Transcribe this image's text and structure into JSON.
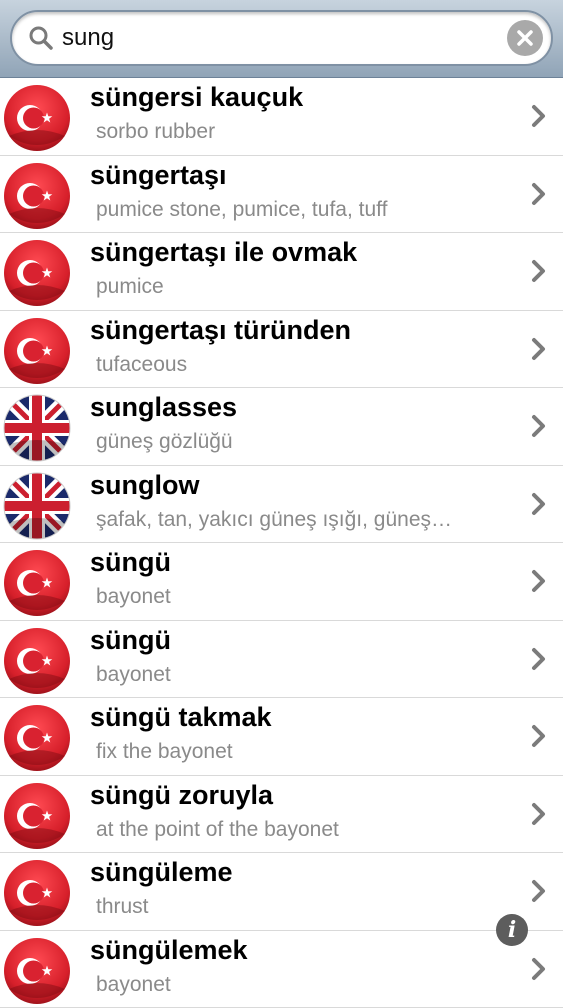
{
  "search": {
    "value": "sung",
    "icon": "search-icon",
    "clear_icon": "clear-icon"
  },
  "colors": {
    "turkish_red": "#d9202b",
    "uk_blue": "#1b2a6b",
    "uk_red": "#cc1f2f",
    "subtitle_gray": "#8a8a8a"
  },
  "results": [
    {
      "flag": "tr",
      "word": "süngersi kauçuk",
      "translation": "sorbo rubber"
    },
    {
      "flag": "tr",
      "word": "süngertaşı",
      "translation": "pumice stone, pumice, tufa, tuff"
    },
    {
      "flag": "tr",
      "word": "süngertaşı ile ovmak",
      "translation": "pumice"
    },
    {
      "flag": "tr",
      "word": "süngertaşı türünden",
      "translation": "tufaceous"
    },
    {
      "flag": "uk",
      "word": "sunglasses",
      "translation": "güneş gözlüğü"
    },
    {
      "flag": "uk",
      "word": "sunglow",
      "translation": "şafak, tan, yakıcı güneş ışığı, güneş…"
    },
    {
      "flag": "tr",
      "word": "süngü",
      "translation": "bayonet"
    },
    {
      "flag": "tr",
      "word": "süngü",
      "translation": "bayonet"
    },
    {
      "flag": "tr",
      "word": "süngü takmak",
      "translation": "fix the bayonet"
    },
    {
      "flag": "tr",
      "word": "süngü zoruyla",
      "translation": "at the point of the bayonet"
    },
    {
      "flag": "tr",
      "word": "süngüleme",
      "translation": "thrust"
    },
    {
      "flag": "tr",
      "word": "süngülemek",
      "translation": "bayonet"
    }
  ],
  "info_button": {
    "label": "i"
  }
}
